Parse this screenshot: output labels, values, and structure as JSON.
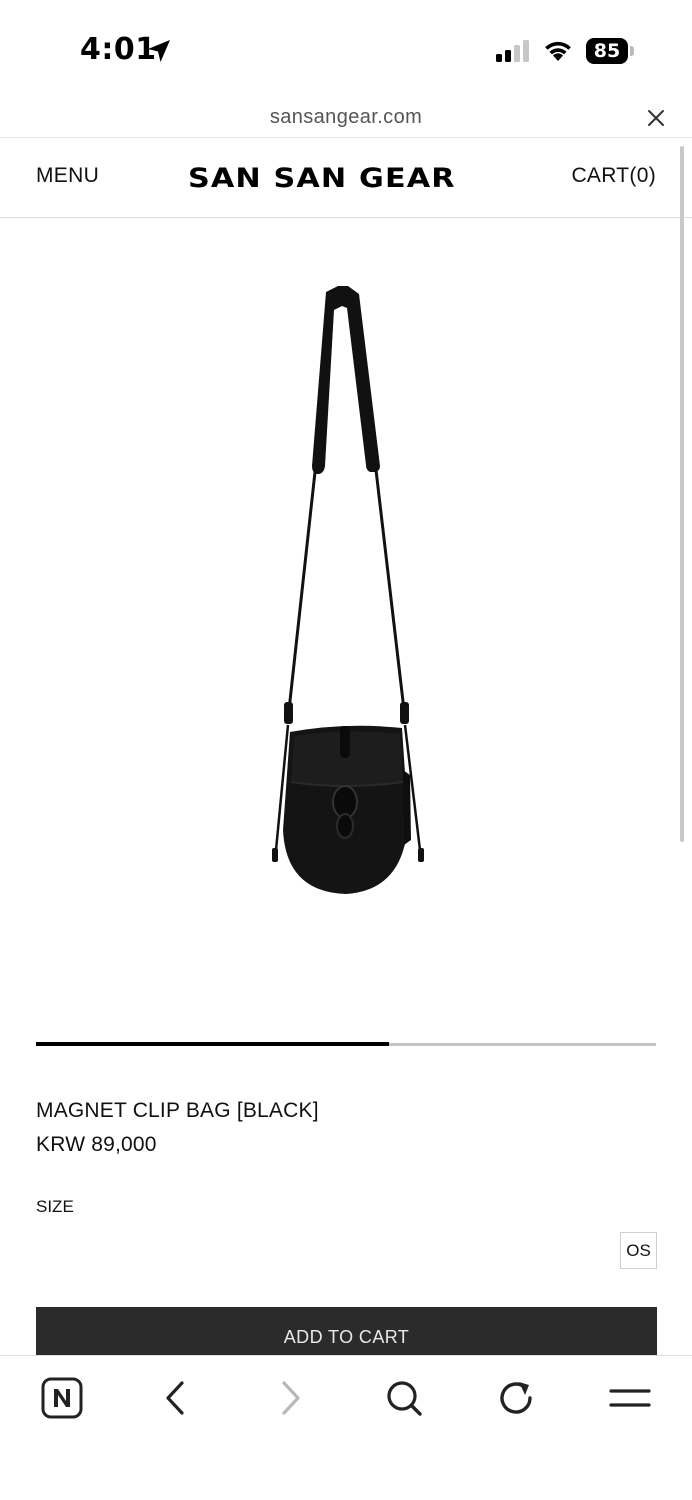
{
  "status_bar": {
    "time": "4:01",
    "battery_level": "85",
    "icons": [
      "location-arrow-icon",
      "cellular-signal-icon",
      "wifi-icon",
      "battery-icon"
    ]
  },
  "browser": {
    "url": "sansangear.com",
    "close_icon": "close-icon"
  },
  "site_header": {
    "menu_label": "MENU",
    "logo_text": "SAN SAN GEAR",
    "cart_label": "CART(0)"
  },
  "product": {
    "image_description_icon": "product-photo",
    "gallery_progress": 0.57,
    "name": "MAGNET CLIP BAG [BLACK]",
    "price": "KRW 89,000",
    "size_label": "SIZE",
    "size_options": [
      "OS"
    ],
    "add_to_cart_label": "ADD TO CART"
  },
  "toolbar": {
    "icons": [
      "naver-icon",
      "back-arrow-icon",
      "forward-arrow-icon",
      "search-icon",
      "reload-icon",
      "menu-icon"
    ]
  },
  "colors": {
    "button_background": "#2b2b2b",
    "progress_active": "#000000",
    "progress_track": "#c4c4c4"
  }
}
